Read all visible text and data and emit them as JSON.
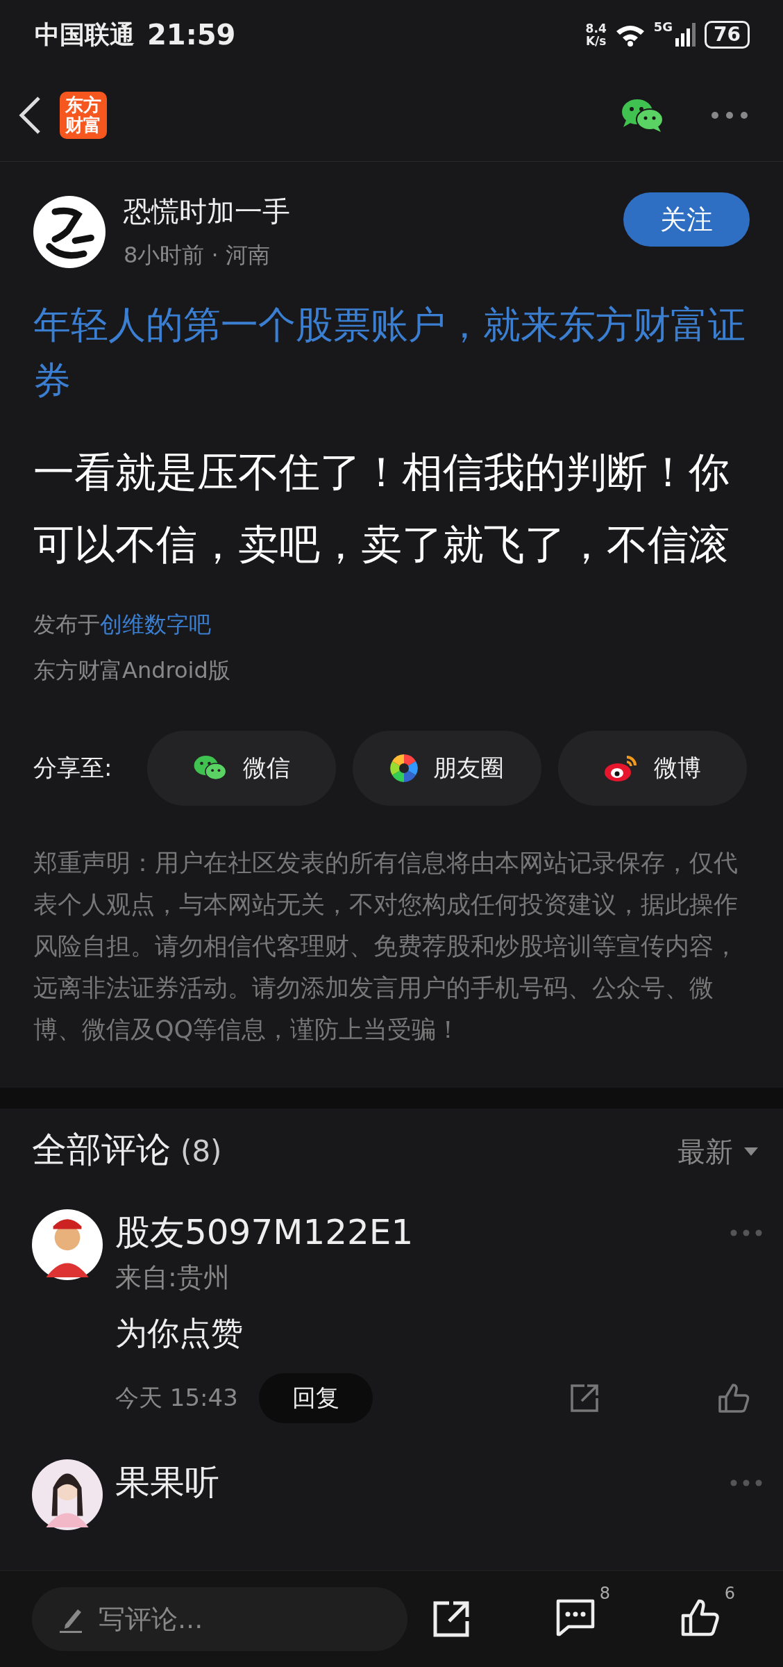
{
  "status_bar": {
    "carrier": "中国联通",
    "time": "21:59",
    "net_speed": "8.4",
    "net_unit": "K/s",
    "network": "5G",
    "battery": "76"
  },
  "header": {
    "logo_lines": [
      "东方",
      "财富"
    ]
  },
  "post": {
    "author": "恐慌时加一手",
    "meta": "8小时前 · 河南",
    "follow_label": "关注",
    "ad_link": "年轻人的第一个股票账户，就来东方财富证券",
    "content": "一看就是压不住了！相信我的判断！你可以不信，卖吧，卖了就飞了，不信滚",
    "published_prefix": "发布于",
    "forum": "创维数字吧",
    "client": "东方财富Android版"
  },
  "share": {
    "label": "分享至:",
    "targets": [
      {
        "kind": "wechat",
        "label": "微信"
      },
      {
        "kind": "moments",
        "label": "朋友圈"
      },
      {
        "kind": "weibo",
        "label": "微博"
      }
    ]
  },
  "disclaimer": "郑重声明：用户在社区发表的所有信息将由本网站记录保存，仅代表个人观点，与本网站无关，不对您构成任何投资建议，据此操作风险自担。请勿相信代客理财、免费荐股和炒股培训等宣传内容，远离非法证券活动。请勿添加发言用户的手机号码、公众号、微博、微信及QQ等信息，谨防上当受骗！",
  "comments": {
    "title": "全部评论",
    "count": "(8)",
    "sort": "最新",
    "items": [
      {
        "author": "股友5097M122E1",
        "location": "来自:贵州",
        "text": "为你点赞",
        "time": "今天 15:43",
        "reply_label": "回复"
      },
      {
        "author": "果果听"
      }
    ]
  },
  "bottom_bar": {
    "placeholder": "写评论...",
    "comment_count": "8",
    "like_count": "6"
  }
}
